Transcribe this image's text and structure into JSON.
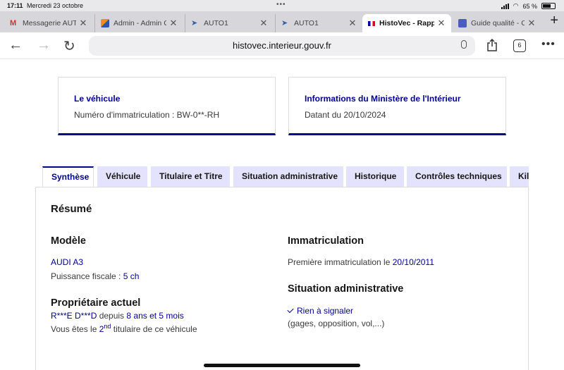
{
  "status": {
    "time": "17:11",
    "date": "Mercredi 23 octobre",
    "battery": "65 %"
  },
  "tabs": [
    {
      "title": "Messagerie AUTO",
      "fav": "gmail-icon",
      "color": "#d93025"
    },
    {
      "title": "Admin - Admin C",
      "fav": "admin-icon",
      "color": "#f08a24"
    },
    {
      "title": "AUTO1",
      "fav": "auto1-icon",
      "color": "#3a5fa8"
    },
    {
      "title": "AUTO1",
      "fav": "auto1-icon",
      "color": "#3a5fa8"
    },
    {
      "title": "HistoVec - Rapp",
      "fav": "french-flag-icon",
      "color": "#000091",
      "active": true
    },
    {
      "title": "Guide qualité - C",
      "fav": "guide-icon",
      "color": "#4a5bc4"
    }
  ],
  "browser": {
    "url": "histovec.interieur.gouv.fr",
    "tab_count": "6"
  },
  "cards": {
    "vehicle": {
      "title": "Le véhicule",
      "text": "Numéro d'immatriculation : BW-0**-RH"
    },
    "ministry": {
      "title": "Informations du Ministère de l'Intérieur",
      "text": "Datant du 20/10/2024"
    }
  },
  "section_tabs": [
    "Synthèse",
    "Véhicule",
    "Titulaire et Titre",
    "Situation administrative",
    "Historique",
    "Contrôles techniques",
    "Kilo"
  ],
  "summary": {
    "heading": "Résumé",
    "model_heading": "Modèle",
    "model": "AUDI A3",
    "power_label": "Puissance fiscale : ",
    "power_value": "5 ch",
    "owner_heading": "Propriétaire actuel",
    "owner_name": "R***E D***D",
    "owner_since_label": " depuis ",
    "owner_since": "8 ans et 5 mois",
    "holder_prefix": "Vous êtes le ",
    "holder_rank": "2",
    "holder_sup": "nd",
    "holder_suffix": " titulaire de ce véhicule",
    "registration_heading": "Immatriculation",
    "first_registration_label": "Première immatriculation le ",
    "first_registration_date": "20/10/2011",
    "admin_heading": "Situation administrative",
    "admin_status": "Rien à signaler",
    "admin_detail": "(gages, opposition, vol,...)"
  }
}
